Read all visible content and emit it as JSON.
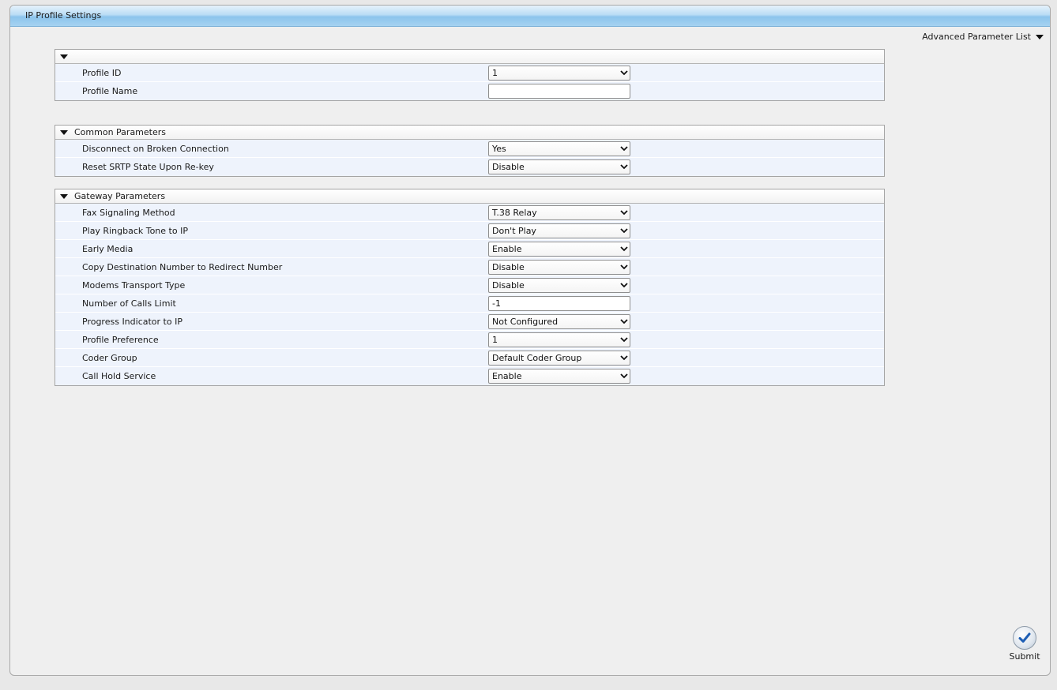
{
  "window": {
    "title": "IP Profile Settings",
    "advanced_link": "Advanced Parameter List",
    "submit_label": "Submit"
  },
  "sections": {
    "main": {
      "title": "",
      "rows": [
        {
          "label": "Profile ID",
          "type": "select",
          "value": "1"
        },
        {
          "label": "Profile Name",
          "type": "text",
          "value": ""
        }
      ]
    },
    "common": {
      "title": "Common Parameters",
      "rows": [
        {
          "label": "Disconnect on Broken Connection",
          "type": "select",
          "value": "Yes"
        },
        {
          "label": "Reset SRTP State Upon Re-key",
          "type": "select",
          "value": "Disable"
        }
      ]
    },
    "gateway": {
      "title": "Gateway Parameters",
      "rows": [
        {
          "label": "Fax Signaling Method",
          "type": "select",
          "value": "T.38 Relay"
        },
        {
          "label": "Play Ringback Tone to IP",
          "type": "select",
          "value": "Don't Play"
        },
        {
          "label": "Early Media",
          "type": "select",
          "value": "Enable"
        },
        {
          "label": "Copy Destination Number to Redirect Number",
          "type": "select",
          "value": "Disable"
        },
        {
          "label": "Modems Transport Type",
          "type": "select",
          "value": "Disable"
        },
        {
          "label": "Number of Calls Limit",
          "type": "text",
          "value": "-1"
        },
        {
          "label": "Progress Indicator to IP",
          "type": "select",
          "value": "Not Configured"
        },
        {
          "label": "Profile Preference",
          "type": "select",
          "value": "1"
        },
        {
          "label": "Coder Group",
          "type": "select",
          "value": "Default Coder Group"
        },
        {
          "label": "Call Hold Service",
          "type": "select",
          "value": "Enable"
        }
      ]
    }
  },
  "colors": {
    "title_bar": "#a5d2f1",
    "row_bg": "#eef3fc",
    "window_bg": "#efefef"
  }
}
